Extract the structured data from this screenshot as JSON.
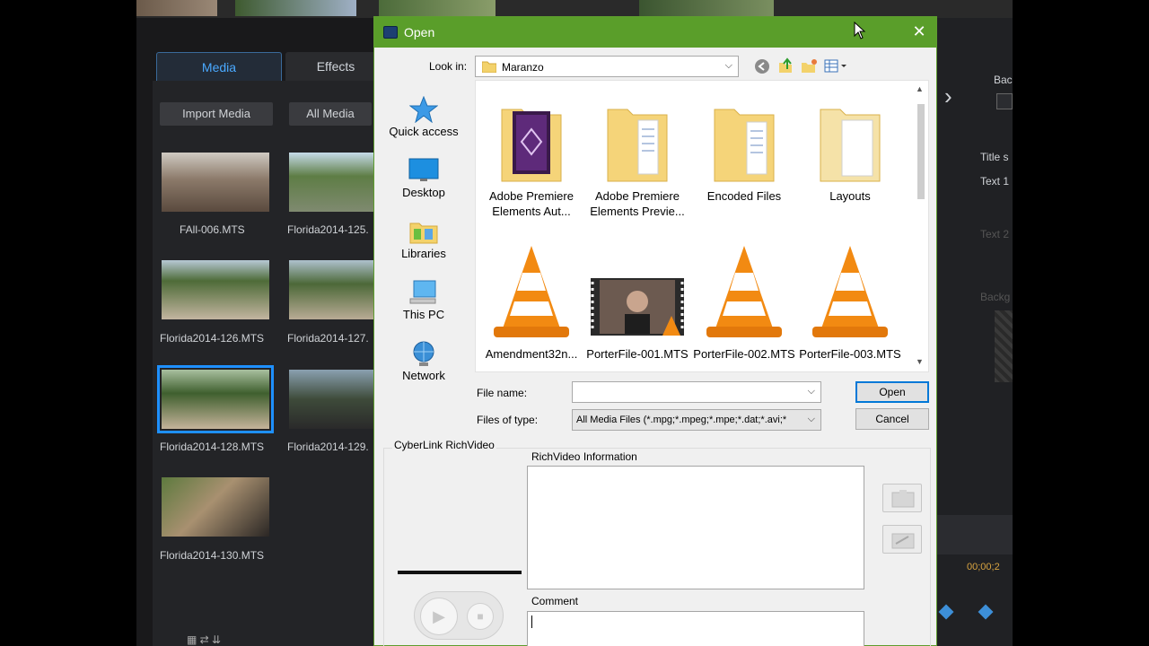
{
  "background_app": {
    "tabs": {
      "media": "Media",
      "effects": "Effects"
    },
    "toolbar": {
      "import_media": "Import Media",
      "all_media": "All Media"
    },
    "media_items": [
      {
        "name": "FAll-006.MTS"
      },
      {
        "name": "Florida2014-125."
      },
      {
        "name": "Florida2014-126.MTS"
      },
      {
        "name": "Florida2014-127."
      },
      {
        "name": "Florida2014-128.MTS",
        "selected": true
      },
      {
        "name": "Florida2014-129."
      },
      {
        "name": "Florida2014-130.MTS"
      }
    ],
    "right_panel": {
      "bac": "Bac",
      "title_s": "Title s",
      "text_1": "Text 1",
      "text_2": "Text 2",
      "backg": "Backg",
      "timecode": "00;00;2"
    }
  },
  "dialog": {
    "title": "Open",
    "look_in_label": "Look in:",
    "look_in_value": "Maranzo",
    "nav_items": [
      {
        "label": "Quick access",
        "icon": "star-icon"
      },
      {
        "label": "Desktop",
        "icon": "desktop-icon"
      },
      {
        "label": "Libraries",
        "icon": "libraries-icon"
      },
      {
        "label": "This PC",
        "icon": "computer-icon"
      },
      {
        "label": "Network",
        "icon": "network-icon"
      }
    ],
    "files": [
      {
        "line1": "Adobe Premiere",
        "line2": "Elements Aut...",
        "icon": "premiere-folder-icon"
      },
      {
        "line1": "Adobe Premiere",
        "line2": "Elements Previe...",
        "icon": "folder-icon"
      },
      {
        "line1": "Encoded Files",
        "line2": "",
        "icon": "folder-icon"
      },
      {
        "line1": "Layouts",
        "line2": "",
        "icon": "folder-icon"
      },
      {
        "line1": "Amendment32n...",
        "line2": "",
        "icon": "vlc-cone-icon"
      },
      {
        "line1": "PorterFile-001.MTS",
        "line2": "",
        "icon": "video-thumbnail-icon"
      },
      {
        "line1": "PorterFile-002.MTS",
        "line2": "",
        "icon": "vlc-cone-icon"
      },
      {
        "line1": "PorterFile-003.MTS",
        "line2": "",
        "icon": "vlc-cone-icon"
      }
    ],
    "file_name_label": "File name:",
    "file_name_value": "",
    "files_of_type_label": "Files of type:",
    "files_of_type_value": "All Media Files (*.mpg;*.mpeg;*.mpe;*.dat;*.avi;*",
    "open_button": "Open",
    "cancel_button": "Cancel",
    "richvideo_group": "CyberLink RichVideo",
    "richvideo_info_label": "RichVideo Information",
    "comment_label": "Comment",
    "comment_value": ""
  },
  "colors": {
    "title_bar": "#5a9e2a",
    "accent": "#0078d7",
    "selection": "#1e90ff"
  }
}
